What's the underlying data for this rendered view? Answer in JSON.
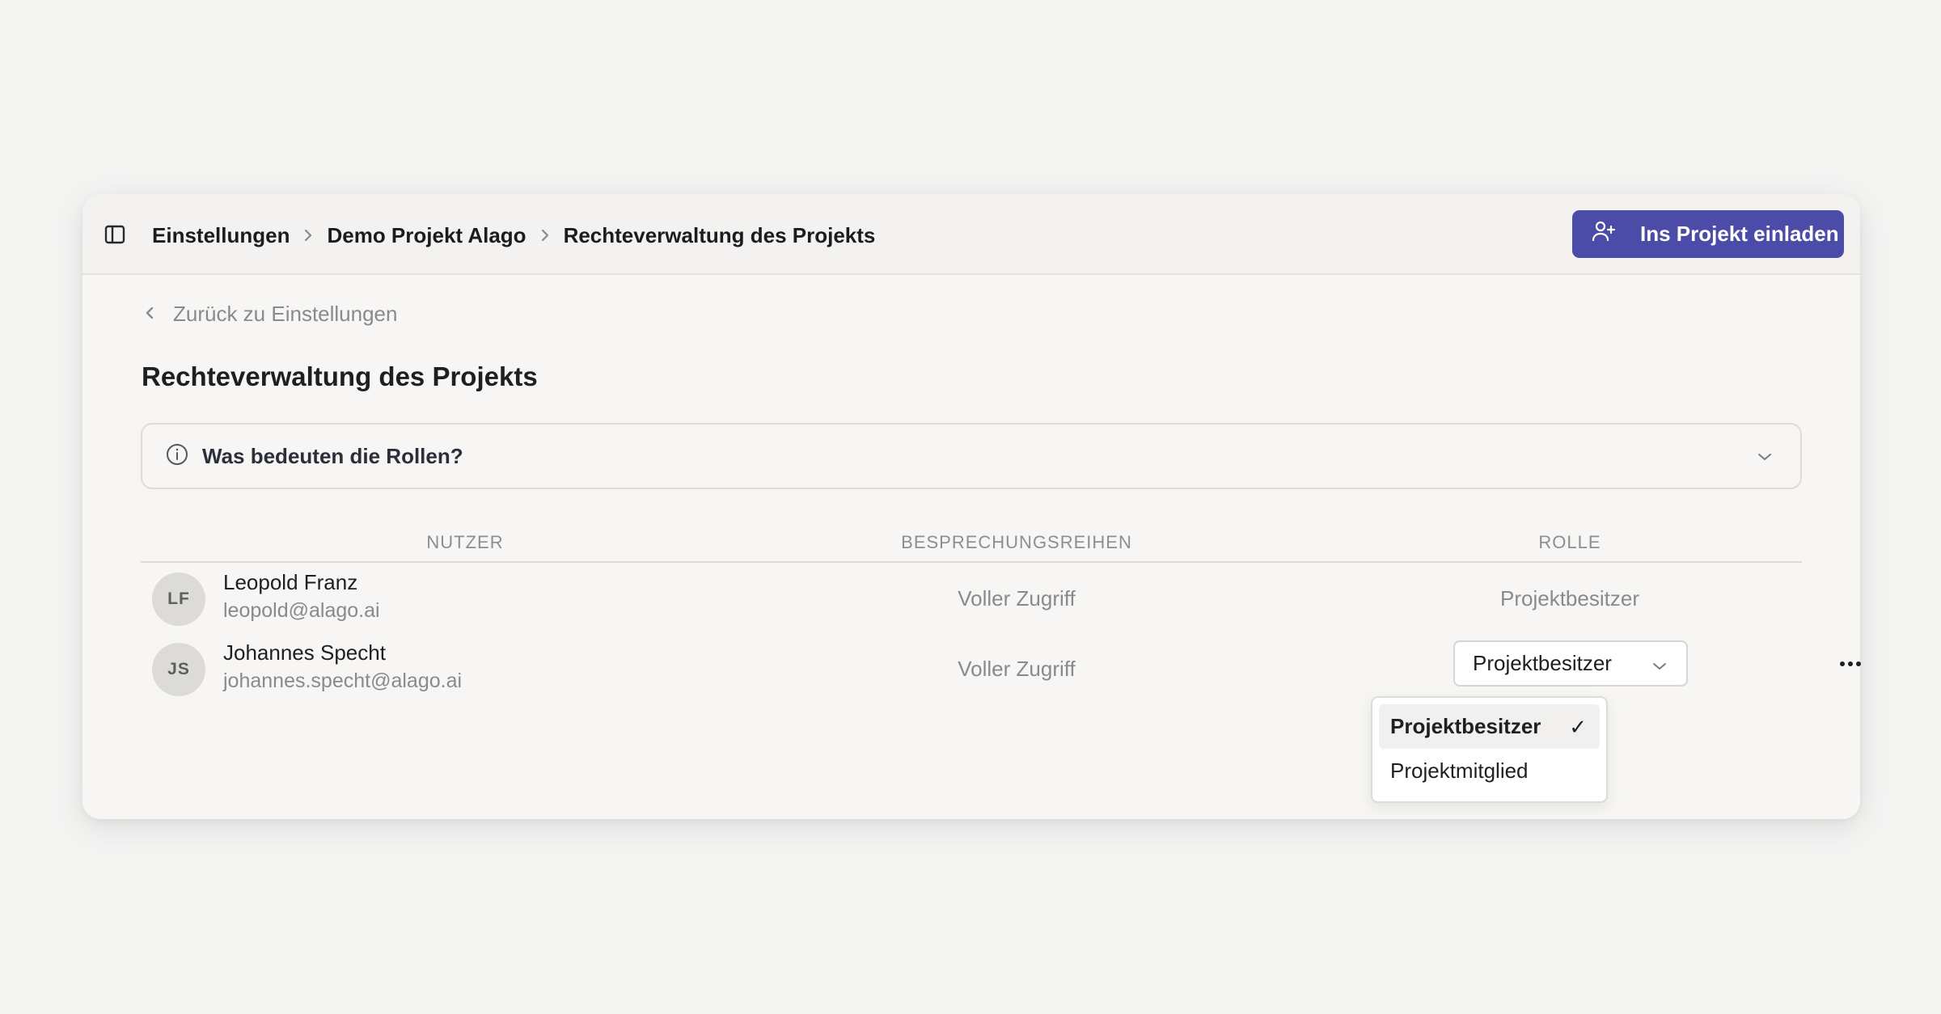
{
  "topbar": {
    "breadcrumb": [
      {
        "label": "Einstellungen"
      },
      {
        "label": "Demo Projekt Alago"
      },
      {
        "label": "Rechteverwaltung des Projekts"
      }
    ],
    "invite_label": "Ins Projekt einladen"
  },
  "colors": {
    "accent": "#4b4ba8",
    "background": "#f4f4f3"
  },
  "back_link": "Zurück zu Einstellungen",
  "page_title": "Rechteverwaltung des Projekts",
  "roles_info": {
    "label": "Was bedeuten die Rollen?"
  },
  "table": {
    "headers": [
      "NUTZER",
      "BESPRECHUNGSREIHEN",
      "ROLLE"
    ],
    "rows": [
      {
        "initials": "LF",
        "name": "Leopold Franz",
        "email": "leopold@alago.ai",
        "meetings": "Voller Zugriff",
        "role": "Projektbesitzer"
      },
      {
        "initials": "JS",
        "name": "Johannes Specht",
        "email": "johannes.specht@alago.ai",
        "meetings": "Voller Zugriff",
        "role": "Projektbesitzer"
      }
    ]
  },
  "role_dropdown": {
    "options": [
      {
        "label": "Projektbesitzer",
        "check": "✓"
      },
      {
        "label": "Projektmitglied"
      }
    ]
  }
}
